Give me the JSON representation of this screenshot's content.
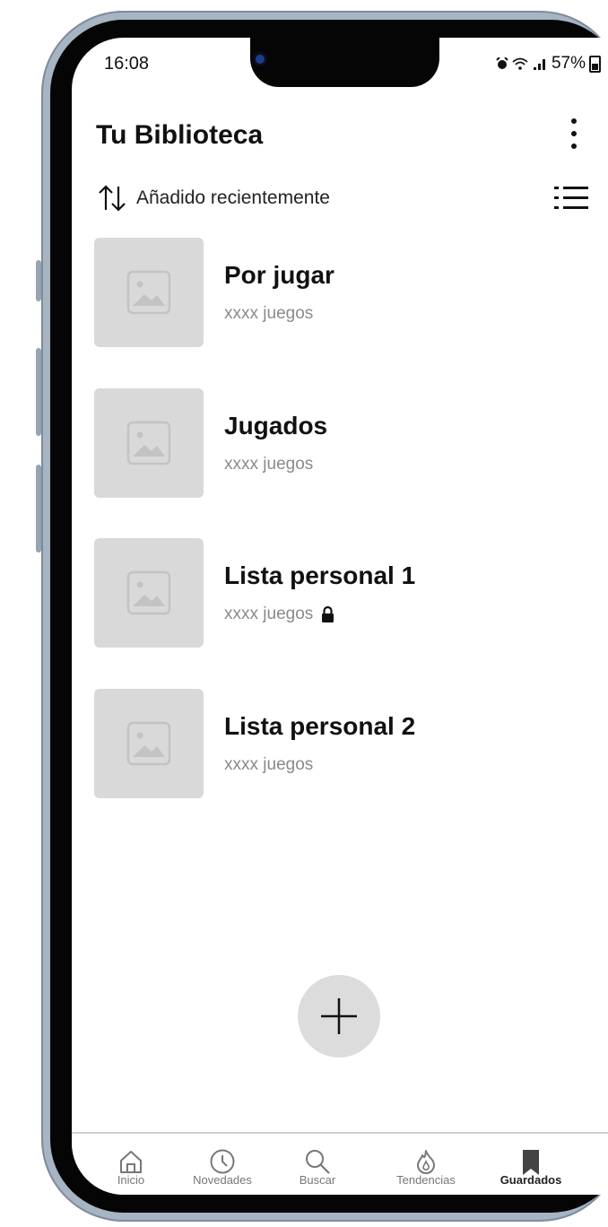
{
  "status_bar": {
    "time": "16:08",
    "battery": "57%"
  },
  "header": {
    "title": "Tu Biblioteca"
  },
  "sort": {
    "label": "Añadido recientemente"
  },
  "lists": [
    {
      "title": "Por jugar",
      "subtitle": "xxxx juegos",
      "locked": false
    },
    {
      "title": "Jugados",
      "subtitle": "xxxx juegos",
      "locked": false
    },
    {
      "title": "Lista personal 1",
      "subtitle": "xxxx juegos",
      "locked": true
    },
    {
      "title": "Lista personal 2",
      "subtitle": "xxxx juegos",
      "locked": false
    }
  ],
  "fab": {
    "icon": "plus-icon"
  },
  "nav": {
    "items": [
      {
        "label": "Inicio",
        "icon": "home-icon",
        "active": false
      },
      {
        "label": "Novedades",
        "icon": "clock-icon",
        "active": false
      },
      {
        "label": "Buscar",
        "icon": "search-icon",
        "active": false
      },
      {
        "label": "Tendencias",
        "icon": "flame-icon",
        "active": false
      },
      {
        "label": "Guardados",
        "icon": "bookmark-icon",
        "active": true
      }
    ]
  },
  "colors": {
    "text": "#111111",
    "muted": "#8a8a8a",
    "placeholder": "#d9d9d9",
    "frame": "#a6b4c3"
  }
}
